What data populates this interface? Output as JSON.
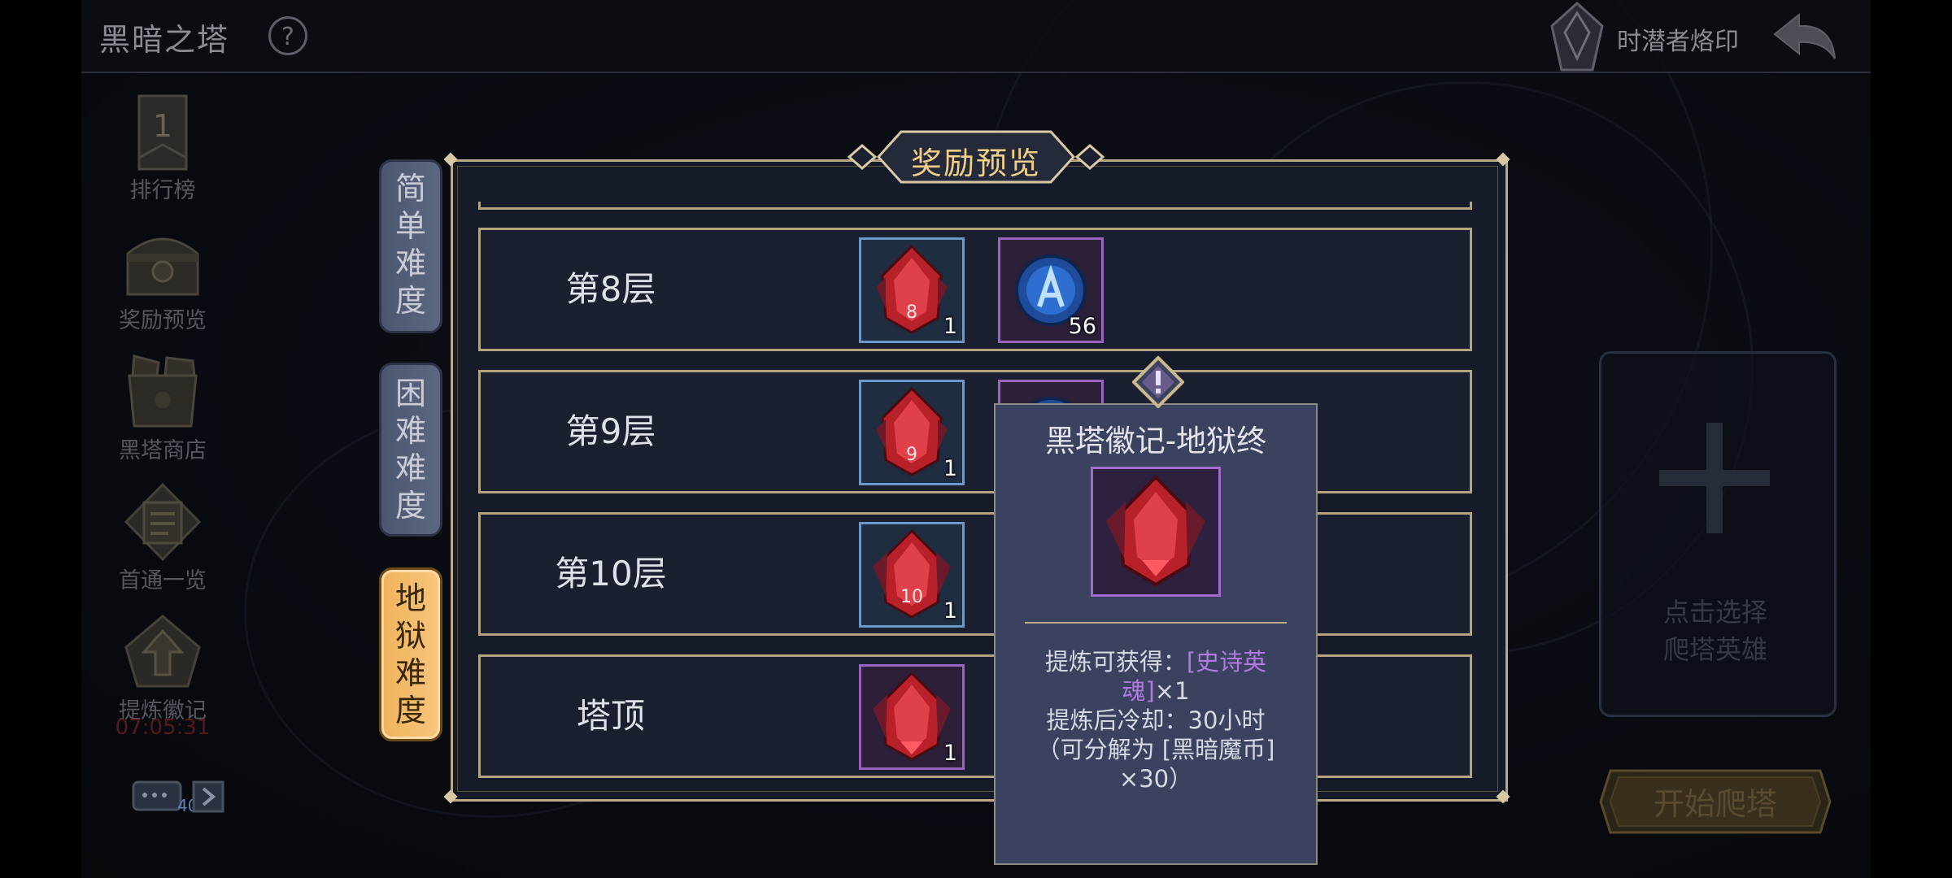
{
  "header": {
    "title": "黑暗之塔",
    "imprint_label": "时潜者烙印"
  },
  "side_menu": {
    "items": [
      {
        "label": "排行榜",
        "icon": "ranking-banner-icon"
      },
      {
        "label": "奖励预览",
        "icon": "treasure-chest-icon"
      },
      {
        "label": "黑塔商店",
        "icon": "shop-crate-icon"
      },
      {
        "label": "首通一览",
        "icon": "scroll-list-icon"
      },
      {
        "label": "提炼徽记",
        "icon": "refine-emblem-icon"
      }
    ],
    "refine_timer": "07:05:31",
    "ranking_badge": "1",
    "chat_count": "40"
  },
  "difficulty_tabs": [
    {
      "label": "简单难度",
      "active": false
    },
    {
      "label": "困难难度",
      "active": false
    },
    {
      "label": "地狱难度",
      "active": true
    }
  ],
  "reward_panel": {
    "title": "奖励预览",
    "rows": [
      {
        "floor": "第8层",
        "rewards": [
          {
            "icon": "red-tower-emblem-icon",
            "mark": "8",
            "count": "1",
            "rarity": "blue"
          },
          {
            "icon": "blue-rune-coin-icon",
            "count": "56",
            "rarity": "purple"
          }
        ]
      },
      {
        "floor": "第9层",
        "rewards": [
          {
            "icon": "red-tower-emblem-icon",
            "mark": "9",
            "count": "1",
            "rarity": "blue"
          },
          {
            "icon": "blue-rune-coin-icon",
            "count": "",
            "rarity": "purple"
          }
        ]
      },
      {
        "floor": "第10层",
        "rewards": [
          {
            "icon": "red-tower-emblem-icon",
            "mark": "10",
            "count": "1",
            "rarity": "blue"
          }
        ]
      },
      {
        "floor": "塔顶",
        "rewards": [
          {
            "icon": "red-tower-emblem-icon",
            "mark": "",
            "count": "1",
            "rarity": "purple"
          }
        ]
      }
    ]
  },
  "tooltip": {
    "title": "黑塔徽记-地狱终",
    "line1_prefix": "提炼可获得：",
    "line1_highlight": "[史诗英魂]",
    "line1_suffix": "×1",
    "line2": "提炼后冷却：30小时",
    "line3": "（可分解为 [黑暗魔币]",
    "line4": "×30）"
  },
  "hero_slot": {
    "hint_line1": "点击选择",
    "hint_line2": "爬塔英雄"
  },
  "start_button": {
    "label": "开始爬塔"
  },
  "colors": {
    "accent_gold": "#f1cf86",
    "active_tab": "#f4bc6c",
    "epic_purple": "#b07ae0",
    "slot_blue": "#6a98c8",
    "slot_purple": "#9b62c0"
  }
}
